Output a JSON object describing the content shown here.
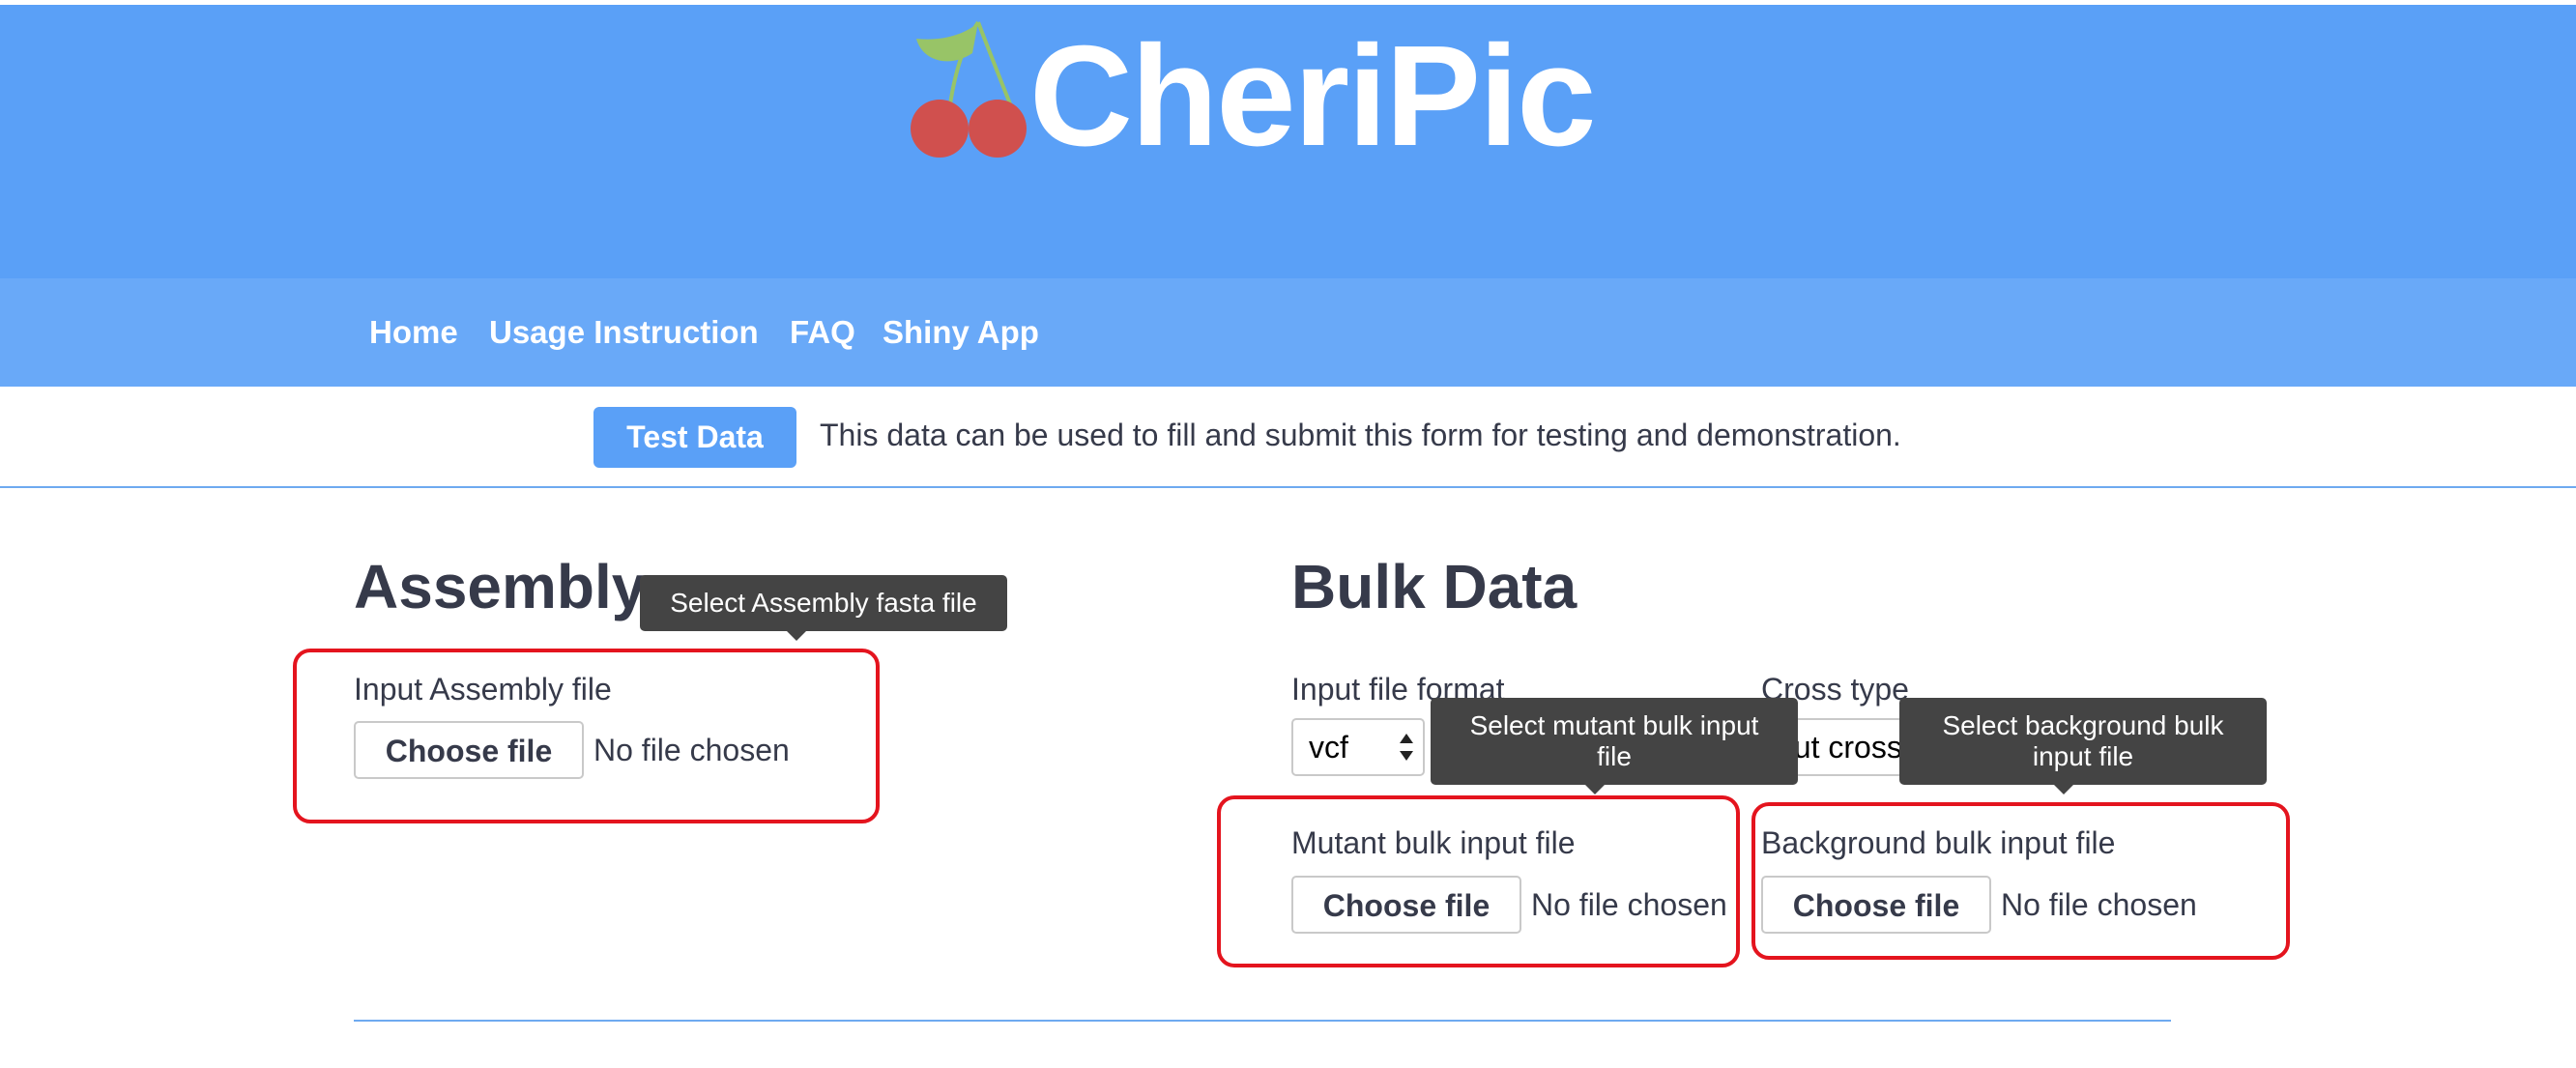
{
  "brand": {
    "name": "CheriPic"
  },
  "nav": {
    "items": [
      {
        "label": "Home"
      },
      {
        "label": "Usage Instruction"
      },
      {
        "label": "FAQ"
      },
      {
        "label": "Shiny App"
      }
    ]
  },
  "test_bar": {
    "button_label": "Test Data",
    "description": "This data can be used to fill and submit this form for testing and demonstration."
  },
  "assembly": {
    "heading": "Assembly",
    "tooltip": "Select Assembly fasta file",
    "input_label": "Input Assembly file",
    "choose_label": "Choose file",
    "status": "No file chosen"
  },
  "bulk": {
    "heading": "Bulk Data",
    "format_label": "Input file format",
    "format_value": "vcf",
    "cross_label": "Cross type",
    "cross_value": "out cross",
    "mutant_tooltip_line1": "Select mutant bulk input",
    "mutant_tooltip_line2": "file",
    "background_tooltip_line1": "Select background bulk",
    "background_tooltip_line2": "input file",
    "mutant_label": "Mutant bulk input file",
    "mutant_choose": "Choose file",
    "mutant_status": "No file chosen",
    "background_label": "Background bulk input file",
    "background_choose": "Choose file",
    "background_status": "No file chosen"
  },
  "colors": {
    "hero": "#5aa0f7",
    "navbar": "#69a9f8",
    "accent_line": "#6eaaf0",
    "highlight": "#e4141e",
    "tooltip": "#444444",
    "text": "#363a4a"
  }
}
